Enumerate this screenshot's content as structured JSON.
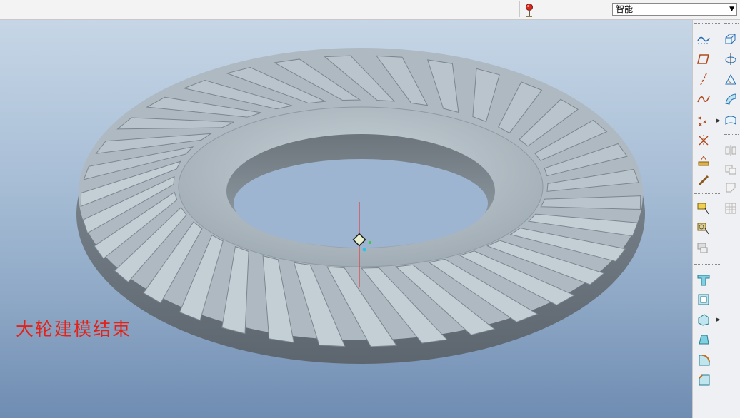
{
  "toolbar_top": {
    "filter_value": "智能",
    "icons": [
      "regenerate-light-icon",
      "dropdown-arrow-icon"
    ]
  },
  "viewport": {
    "caption": "大轮建模结束",
    "model": "spiral-bevel-gear",
    "colors": {
      "caption": "#e2231a",
      "gear": "#b4c0c8",
      "background_top": "#c6d6e6",
      "background_bottom": "#6f8cb2"
    }
  },
  "right_toolbar": {
    "column1": [
      "sketch-datum-icon",
      "datum-plane-icon",
      "datum-axis-icon",
      "datum-curve-icon",
      "datum-point-icon",
      "datum-csys-icon",
      "analysis-icon",
      "chain-icon",
      "feature-insert-icon",
      "feature-insert-2-icon",
      "feature-insert-3-icon",
      "hole-icon",
      "shell-icon",
      "rib-icon",
      "draft-icon",
      "round-icon",
      "chamfer-icon"
    ],
    "column2": [
      "extrude-icon",
      "revolve-icon",
      "sweep-icon",
      "blend-icon",
      "boundary-icon",
      "mirror-icon",
      "merge-icon",
      "trim-icon",
      "pattern-icon"
    ]
  }
}
